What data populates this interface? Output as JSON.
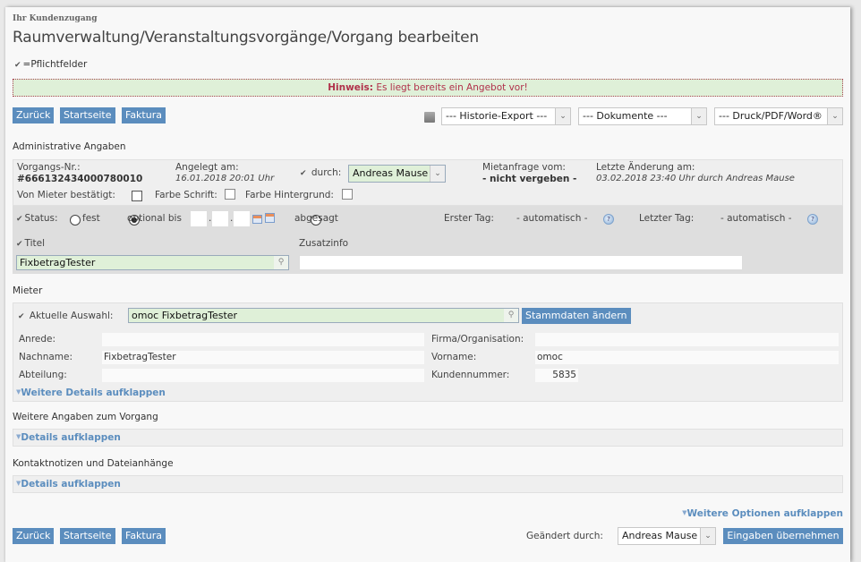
{
  "header": {
    "breadcrumb": "Ihr Kundenzugang",
    "title": "Raumverwaltung/Veranstaltungsvorgänge/Vorgang bearbeiten",
    "required_legend": "=Pflichtfelder"
  },
  "notice": {
    "label": "Hinweis:",
    "text": " Es liegt bereits ein Angebot vor!"
  },
  "toolbar": {
    "back": "Zurück",
    "start": "Startseite",
    "billing": "Faktura",
    "history_export": "--- Historie-Export ---",
    "documents": "--- Dokumente ---",
    "print": "--- Druck/PDF/Word®"
  },
  "admin": {
    "section": "Administrative Angaben",
    "vorgang_label": "Vorgangs-Nr.:",
    "vorgang_value": "#666132434000780010",
    "created_label": "Angelegt am:",
    "created_value": "16.01.2018 20:01 Uhr",
    "by_label": "durch:",
    "by_value": "Andreas Mause",
    "request_label": "Mietanfrage vom:",
    "request_value": "- nicht vergeben -",
    "changed_label": "Letzte Änderung am:",
    "changed_value": "03.02.2018 23:40 Uhr durch Andreas Mause",
    "confirmed_label": "Von Mieter bestätigt:",
    "font_color_label": "Farbe Schrift:",
    "bg_color_label": "Farbe Hintergrund:",
    "confirmed": false,
    "font_color": false,
    "bg_color": false
  },
  "status": {
    "label": "Status:",
    "options": [
      "fest",
      "optional bis",
      "abgesagt"
    ],
    "selected": "optional bis",
    "first_day_label": "Erster Tag:",
    "first_day_value": "- automatisch -",
    "last_day_label": "Letzter Tag:",
    "last_day_value": "- automatisch -",
    "title_label": "Titel",
    "title_value": "FixbetragTester",
    "extra_label": "Zusatzinfo",
    "extra_value": ""
  },
  "tenant": {
    "section": "Mieter",
    "current_label": "Aktuelle Auswahl:",
    "current_value": "omoc FixbetragTester",
    "edit_button": "Stammdaten ändern",
    "salutation_label": "Anrede:",
    "salutation_value": "",
    "lastname_label": "Nachname:",
    "lastname_value": "FixbetragTester",
    "department_label": "Abteilung:",
    "department_value": "",
    "company_label": "Firma/Organisation:",
    "company_value": "",
    "firstname_label": "Vorname:",
    "firstname_value": "omoc",
    "customer_no_label": "Kundennummer:",
    "customer_no_value": "5835",
    "more_details": "Weitere Details aufklappen"
  },
  "more_info": {
    "section": "Weitere Angaben zum Vorgang",
    "expand": "Details aufklappen"
  },
  "notes": {
    "section": "Kontaktnotizen und Dateianhänge",
    "expand": "Details aufklappen"
  },
  "footer": {
    "more_options": "Weitere Optionen aufklappen",
    "changed_by_label": "Geändert durch:",
    "changed_by_value": "Andreas Mause",
    "submit": "Eingaben übernehmen",
    "back": "Zurück",
    "start": "Startseite",
    "billing": "Faktura"
  },
  "colors": {
    "accent": "#5b8dbe",
    "notice_bg": "#dff0d8",
    "notice_text": "#b0304a"
  }
}
